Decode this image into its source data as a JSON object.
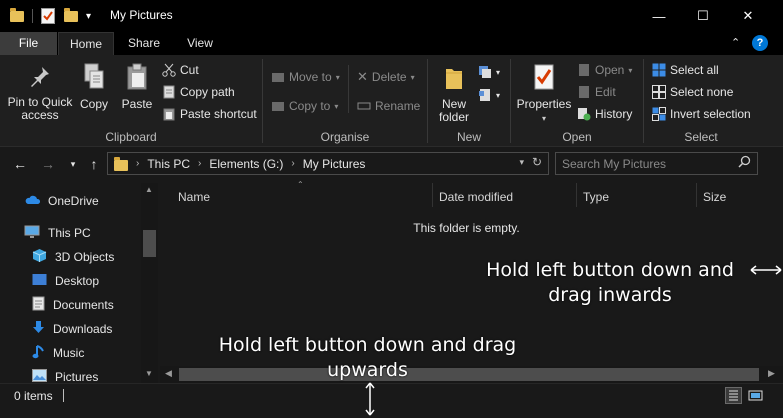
{
  "window": {
    "title": "My Pictures",
    "caption": {
      "minimize": "—",
      "maximize": "☐",
      "close": "✕"
    }
  },
  "ribbon_tabs": [
    {
      "label": "File",
      "active": false
    },
    {
      "label": "Home",
      "active": true
    },
    {
      "label": "Share",
      "active": false
    },
    {
      "label": "View",
      "active": false
    }
  ],
  "ribbon": {
    "clipboard": {
      "label": "Clipboard",
      "pin": "Pin to Quick access",
      "copy": "Copy",
      "paste": "Paste",
      "cut": "Cut",
      "copy_path": "Copy path",
      "paste_shortcut": "Paste shortcut"
    },
    "organise": {
      "label": "Organise",
      "move_to": "Move to",
      "copy_to": "Copy to",
      "delete": "Delete",
      "rename": "Rename"
    },
    "new": {
      "label": "New",
      "new_folder": "New folder"
    },
    "open": {
      "label": "Open",
      "properties": "Properties",
      "open": "Open",
      "edit": "Edit",
      "history": "History"
    },
    "select": {
      "label": "Select",
      "select_all": "Select all",
      "select_none": "Select none",
      "invert": "Invert selection"
    }
  },
  "address": {
    "crumbs": [
      "This PC",
      "Elements (G:)",
      "My Pictures"
    ],
    "search_placeholder": "Search My Pictures"
  },
  "nav_pane": {
    "items": [
      "OneDrive",
      "This PC",
      "3D Objects",
      "Desktop",
      "Documents",
      "Downloads",
      "Music",
      "Pictures"
    ]
  },
  "columns": [
    "Name",
    "Date modified",
    "Type",
    "Size"
  ],
  "empty_text": "This folder is empty.",
  "status": {
    "items": "0 items"
  },
  "annotations": {
    "right_line1": "Hold left button down and",
    "right_line2": "drag inwards",
    "bottom_line1": "Hold left button down and drag",
    "bottom_line2": "upwards"
  },
  "colors": {
    "accent": "#0078d7",
    "folder": "#e8c15a",
    "background": "#191919"
  }
}
